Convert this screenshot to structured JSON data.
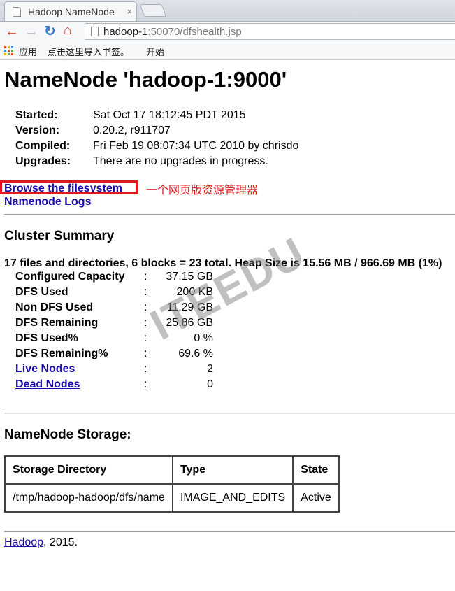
{
  "browser": {
    "tab_title": "Hadoop NameNode",
    "tab_close": "×",
    "url_host": "hadoop-1",
    "url_rest": ":50070/dfshealth.jsp",
    "bookmarks": [
      "应用",
      "点击这里导入书签。",
      "开始"
    ],
    "icons": {
      "back": "←",
      "forward": "→",
      "reload": "↻",
      "home": "⌂"
    }
  },
  "page": {
    "title": "NameNode 'hadoop-1:9000'",
    "info": [
      {
        "label": "Started:",
        "value": "Sat Oct 17 18:12:45 PDT 2015"
      },
      {
        "label": "Version:",
        "value": "0.20.2, r911707"
      },
      {
        "label": "Compiled:",
        "value": "Fri Feb 19 08:07:34 UTC 2010 by chrisdo"
      },
      {
        "label": "Upgrades:",
        "value": "There are no upgrades in progress."
      }
    ],
    "links": {
      "browse": "Browse the filesystem",
      "logs": "Namenode Logs"
    },
    "annotation": "一个网页版资源管理器",
    "annotation_color": "#e0191f",
    "cluster_heading": "Cluster Summary",
    "cluster_line": "17 files and directories, 6 blocks = 23 total. Heap Size is 15.56 MB / 966.69 MB (1%)",
    "stats": [
      {
        "label": "Configured Capacity",
        "value": "37.15 GB",
        "link": false
      },
      {
        "label": "DFS Used",
        "value": "200 KB",
        "link": false
      },
      {
        "label": "Non DFS Used",
        "value": "11.29 GB",
        "link": false
      },
      {
        "label": "DFS Remaining",
        "value": "25.86 GB",
        "link": false
      },
      {
        "label": "DFS Used%",
        "value": "0 %",
        "link": false
      },
      {
        "label": "DFS Remaining%",
        "value": "69.6 %",
        "link": false
      },
      {
        "label": "Live Nodes",
        "value": "2",
        "link": true
      },
      {
        "label": "Dead Nodes",
        "value": "0",
        "link": true
      }
    ],
    "colon": ":",
    "storage_heading": "NameNode Storage:",
    "storage_table": {
      "headers": [
        "Storage Directory",
        "Type",
        "State"
      ],
      "rows": [
        [
          "/tmp/hadoop-hadoop/dfs/name",
          "IMAGE_AND_EDITS",
          "Active"
        ]
      ]
    },
    "footer_link": "Hadoop",
    "footer_text": ", 2015.",
    "watermark": "ITEEDU",
    "link_color": "#1a0dab"
  }
}
